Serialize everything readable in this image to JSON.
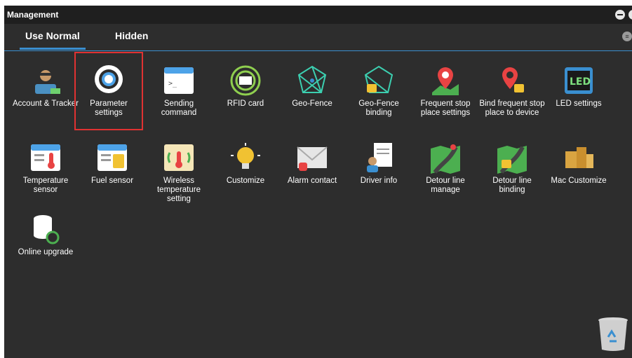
{
  "window": {
    "title": "Management"
  },
  "tabs": [
    {
      "label": "Use Normal",
      "active": true
    },
    {
      "label": "Hidden",
      "active": false
    }
  ],
  "items": [
    {
      "label": "Account & Tracker",
      "icon": "account-tracker-icon"
    },
    {
      "label": "Parameter settings",
      "icon": "gear-icon",
      "selected": true
    },
    {
      "label": "Sending command",
      "icon": "terminal-window-icon"
    },
    {
      "label": "RFID card",
      "icon": "rfid-card-icon"
    },
    {
      "label": "Geo-Fence",
      "icon": "network-globe-icon"
    },
    {
      "label": "Geo-Fence binding",
      "icon": "network-lock-icon"
    },
    {
      "label": "Frequent stop place settings",
      "icon": "parking-pin-icon"
    },
    {
      "label": "Bind frequent stop place to device",
      "icon": "pin-lock-icon"
    },
    {
      "label": "LED settings",
      "icon": "led-display-icon"
    },
    {
      "label": "Temperature sensor",
      "icon": "thermometer-window-icon"
    },
    {
      "label": "Fuel sensor",
      "icon": "fuel-window-icon"
    },
    {
      "label": "Wireless temperature setting",
      "icon": "wireless-thermometer-icon"
    },
    {
      "label": "Customize",
      "icon": "lightbulb-icon"
    },
    {
      "label": "Alarm contact",
      "icon": "envelope-alarm-icon"
    },
    {
      "label": "Driver info",
      "icon": "driver-document-icon"
    },
    {
      "label": "Detour line manage",
      "icon": "road-map-icon"
    },
    {
      "label": "Detour line binding",
      "icon": "road-map-lock-icon"
    },
    {
      "label": "Mac Customize",
      "icon": "boxes-icon"
    },
    {
      "label": "Online upgrade",
      "icon": "database-refresh-icon"
    }
  ],
  "colors": {
    "background": "#2d2d2d",
    "titlebar": "#1f1f1f",
    "accent": "#3a8fd0",
    "selection": "#e03232"
  }
}
